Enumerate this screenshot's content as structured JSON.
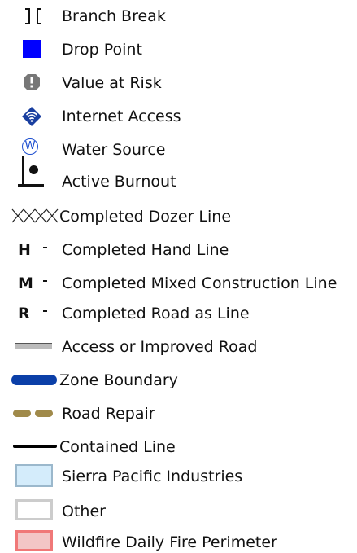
{
  "legend": {
    "items": [
      {
        "symbol": "branch-break-icon",
        "label": "Branch Break"
      },
      {
        "symbol": "drop-point-icon",
        "label": "Drop Point",
        "color": "#0000FF"
      },
      {
        "symbol": "value-at-risk-icon",
        "label": "Value at Risk",
        "color": "#777777"
      },
      {
        "symbol": "internet-access-icon",
        "label": "Internet Access",
        "color": "#1A3FA0"
      },
      {
        "symbol": "water-source-icon",
        "label": "Water Source",
        "color": "#1E4FD0",
        "glyph": "W"
      },
      {
        "symbol": "active-burnout-icon",
        "label": "Active Burnout"
      },
      {
        "symbol": "dozer-line-icon",
        "label": "Completed Dozer Line"
      },
      {
        "symbol": "hand-line-icon",
        "label": "Completed Hand Line",
        "glyph": "H"
      },
      {
        "symbol": "mixed-line-icon",
        "label": "Completed Mixed Construction Line",
        "glyph": "M"
      },
      {
        "symbol": "road-as-line-icon",
        "label": "Completed Road as Line",
        "glyph": "R"
      },
      {
        "symbol": "improved-road-icon",
        "label": "Access or Improved Road",
        "color": "#BBBBBB"
      },
      {
        "symbol": "zone-boundary-icon",
        "label": "Zone Boundary",
        "color": "#0B3FA8"
      },
      {
        "symbol": "road-repair-icon",
        "label": "Road Repair",
        "color": "#A08A4A"
      },
      {
        "symbol": "contained-line-icon",
        "label": "Contained Line",
        "color": "#000000"
      },
      {
        "symbol": "sierra-pacific-swatch",
        "label": "Sierra Pacific Industries",
        "color": "#D4ECFB"
      },
      {
        "symbol": "other-swatch",
        "label": "Other",
        "color": "#CCCCCC"
      },
      {
        "symbol": "fire-perimeter-swatch",
        "label": "Wildfire Daily Fire Perimeter",
        "color": "#F3C6C6"
      }
    ]
  }
}
